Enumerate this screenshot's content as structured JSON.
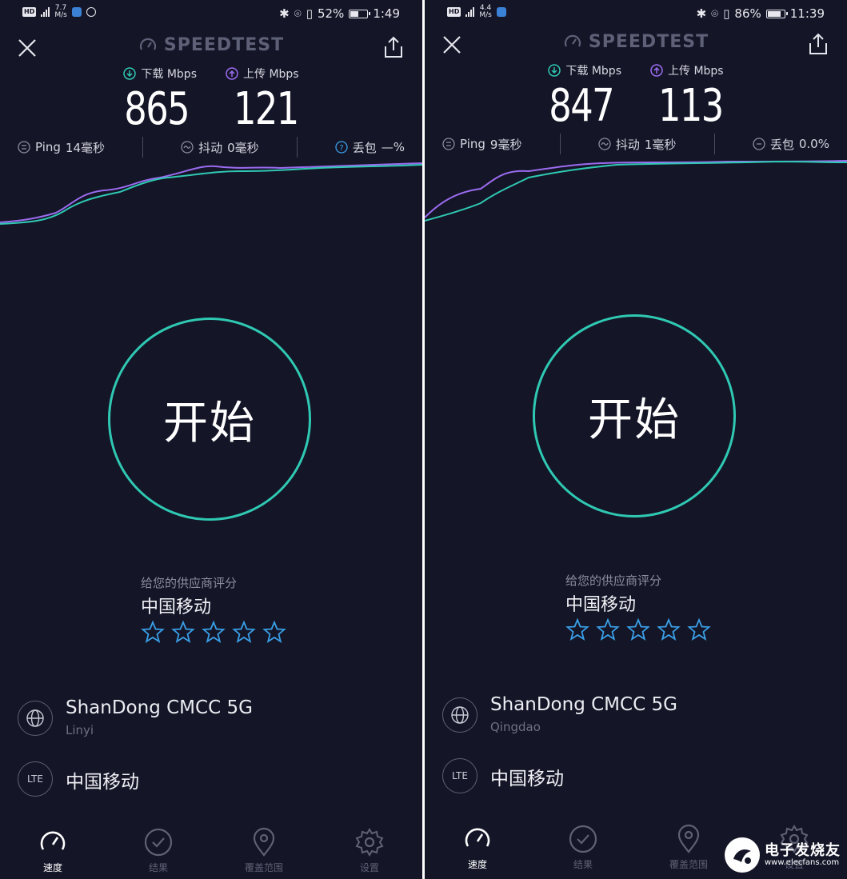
{
  "common": {
    "logo": "SPEEDTEST",
    "download_label": "下载 Mbps",
    "upload_label": "上传 Mbps",
    "ping_label": "Ping",
    "jitter_label": "抖动",
    "loss_label": "丢包",
    "start_label": "开始",
    "rating_prompt": "给您的供应商评分",
    "nav": [
      "速度",
      "结果",
      "覆盖范围",
      "设置"
    ],
    "colors": {
      "background": "#141527",
      "accent": "#2fc8b2",
      "download": "#2fc8b2",
      "upload": "#9b6cf0",
      "star": "#3aa0e8"
    }
  },
  "panels": [
    {
      "status": {
        "net_speed": "7.7",
        "net_unit": "M/s",
        "battery": "52%",
        "battery_level": 0.52,
        "time": "1:49"
      },
      "download": "865",
      "upload": "121",
      "ping": "14毫秒",
      "jitter": "0毫秒",
      "loss": "—%",
      "provider": "中国移动",
      "server_name": "ShanDong CMCC 5G",
      "server_location": "Linyi",
      "carrier": "中国移动",
      "rating_stars": 0
    },
    {
      "status": {
        "net_speed": "4.4",
        "net_unit": "M/s",
        "battery": "86%",
        "battery_level": 0.86,
        "time": "11:39"
      },
      "download": "847",
      "upload": "113",
      "ping": "9毫秒",
      "jitter": "1毫秒",
      "loss": "0.0%",
      "provider": "中国移动",
      "server_name": "ShanDong CMCC 5G",
      "server_location": "Qingdao",
      "carrier": "中国移动",
      "rating_stars": 0
    }
  ],
  "watermark": {
    "cn": "电子发烧友",
    "en": "www.elecfans.com"
  }
}
